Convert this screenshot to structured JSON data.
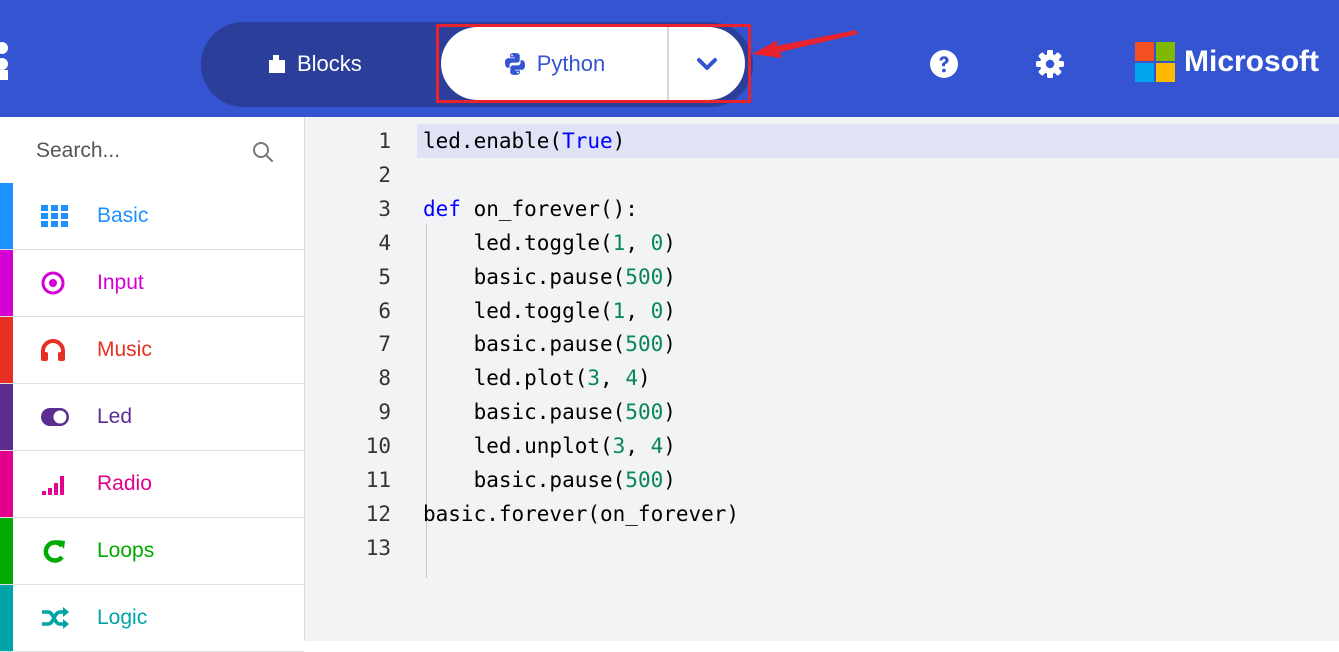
{
  "header": {
    "tabs": {
      "blocks_label": "Blocks",
      "python_label": "Python"
    },
    "brand": "Microsoft",
    "colors": {
      "bar": "#3454d1",
      "switch": "#2a3e9a",
      "annotation": "#e8232e"
    },
    "icons": [
      "help-icon",
      "gear-icon",
      "chevron-down-icon",
      "puzzle-icon",
      "python-icon"
    ]
  },
  "sidebar": {
    "search": {
      "placeholder": "Search..."
    },
    "categories": [
      {
        "label": "Basic",
        "color": "#1e90ff",
        "icon": "grid-icon"
      },
      {
        "label": "Input",
        "color": "#d400d4",
        "icon": "target-icon"
      },
      {
        "label": "Music",
        "color": "#e63022",
        "icon": "headphones-icon"
      },
      {
        "label": "Led",
        "color": "#5c2d91",
        "icon": "toggle-icon"
      },
      {
        "label": "Radio",
        "color": "#e3008c",
        "icon": "signal-bars-icon"
      },
      {
        "label": "Loops",
        "color": "#00aa00",
        "icon": "loop-icon"
      },
      {
        "label": "Logic",
        "color": "#00a4a6",
        "icon": "shuffle-icon"
      }
    ]
  },
  "editor": {
    "lines": [
      {
        "n": "1",
        "text": "led.enable(True)"
      },
      {
        "n": "2",
        "text": ""
      },
      {
        "n": "3",
        "text": "def on_forever():"
      },
      {
        "n": "4",
        "text": "    led.toggle(1, 0)"
      },
      {
        "n": "5",
        "text": "    basic.pause(500)"
      },
      {
        "n": "6",
        "text": "    led.toggle(1, 0)"
      },
      {
        "n": "7",
        "text": "    basic.pause(500)"
      },
      {
        "n": "8",
        "text": "    led.plot(3, 4)"
      },
      {
        "n": "9",
        "text": "    basic.pause(500)"
      },
      {
        "n": "10",
        "text": "    led.unplot(3, 4)"
      },
      {
        "n": "11",
        "text": "    basic.pause(500)"
      },
      {
        "n": "12",
        "text": "basic.forever(on_forever)"
      },
      {
        "n": "13",
        "text": ""
      }
    ],
    "active_line": 1
  }
}
